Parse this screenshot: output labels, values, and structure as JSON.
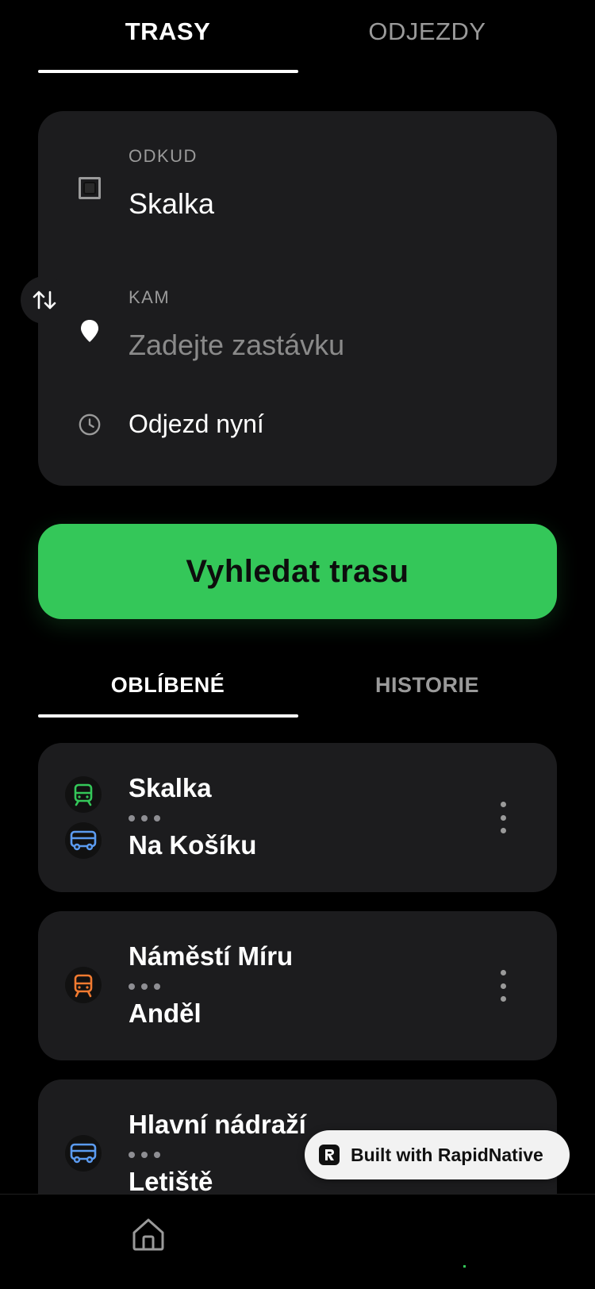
{
  "top_tabs": [
    {
      "label": "TRASY",
      "active": true
    },
    {
      "label": "ODJEZDY",
      "active": false
    }
  ],
  "form": {
    "from_label": "ODKUD",
    "from_value": "Skalka",
    "to_label": "KAM",
    "to_placeholder": "Zadejte zastávku",
    "time_value": "Odjezd nyní"
  },
  "search_button": {
    "label": "Vyhledat trasu"
  },
  "sub_tabs": [
    {
      "label": "OBLÍBENÉ",
      "active": true
    },
    {
      "label": "HISTORIE",
      "active": false
    }
  ],
  "favorites": [
    {
      "from": "Skalka",
      "to": "Na Košíku",
      "modes": [
        "metro",
        "bus"
      ]
    },
    {
      "from": "Náměstí Míru",
      "to": "Anděl",
      "modes": [
        "tram"
      ]
    },
    {
      "from": "Hlavní nádraží",
      "to": "Letiště",
      "modes": [
        "bus"
      ]
    }
  ],
  "colors": {
    "accent": "#34c759",
    "metro": "#34c759",
    "bus": "#5b9bf0",
    "tram": "#f07a30",
    "card": "#1c1c1e",
    "background": "#000000"
  },
  "badge": {
    "text": "Built with RapidNative"
  },
  "bottom_nav": {
    "home_icon": "home-icon"
  }
}
